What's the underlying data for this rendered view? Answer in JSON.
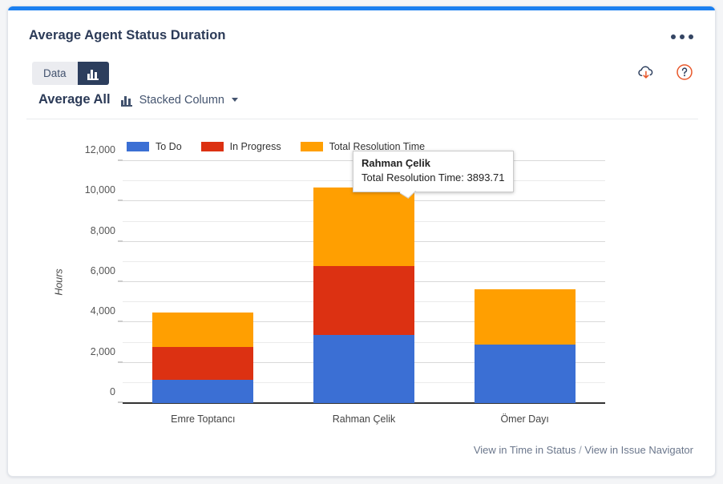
{
  "gadget": {
    "title": "Average Agent Status Duration",
    "more_menu_label": "More actions",
    "accent_color": "#1a7ff0"
  },
  "tabs": [
    {
      "id": "data",
      "label": "Data",
      "icon": "",
      "active": false
    },
    {
      "id": "chart",
      "label": "",
      "icon": "bar-chart-icon",
      "active": true
    }
  ],
  "icons": {
    "download": "cloud-download-icon",
    "help": "help-circle-icon"
  },
  "controls": {
    "aggregation_label": "Average All",
    "chart_type_icon": "bar-chart-icon",
    "chart_type_label": "Stacked Column",
    "chart_type_caret": "chevron-down-icon"
  },
  "tooltip": {
    "title": "Rahman Çelik",
    "line": "Total Resolution Time: 3893.71"
  },
  "footer": {
    "link_time_in_status": "View in Time in Status",
    "separator": "/",
    "link_issue_navigator": "View in Issue Navigator"
  },
  "chart_data": {
    "type": "bar",
    "stacked": true,
    "title": "Average Agent Status Duration",
    "xlabel": "",
    "ylabel": "Hours",
    "ylim": [
      0,
      12000
    ],
    "ytick_step": 2000,
    "minor_gridline_step": 1000,
    "grid": true,
    "legend_position": "top-left",
    "categories": [
      "Emre Toptancı",
      "Rahman Çelik",
      "Ömer Dayı"
    ],
    "yticks": [
      "0",
      "2,000",
      "4,000",
      "6,000",
      "8,000",
      "10,000",
      "12,000"
    ],
    "series": [
      {
        "name": "To Do",
        "color": "#3b6fd4",
        "values": [
          1155,
          3377,
          2900
        ]
      },
      {
        "name": "In Progress",
        "color": "#dc3112",
        "values": [
          1625,
          3417,
          0
        ]
      },
      {
        "name": "Total Resolution Time",
        "color": "#ff9f01",
        "values": [
          1715,
          3893.71,
          2741
        ]
      }
    ],
    "totals": [
      4495,
      10687.71,
      5641
    ]
  }
}
